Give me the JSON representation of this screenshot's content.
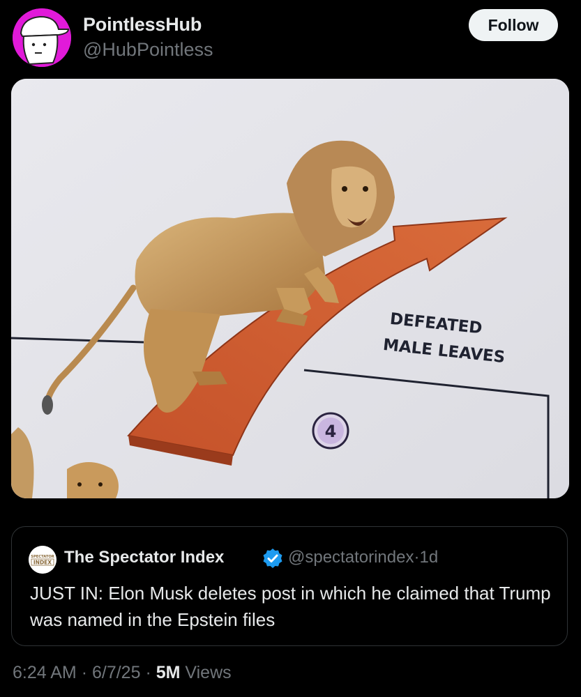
{
  "post": {
    "display_name": "PointlessHub",
    "handle": "@HubPointless",
    "follow_label": "Follow",
    "avatar_color": "#e11ad9"
  },
  "media": {
    "sign_line1": "DEFEATED",
    "sign_line2": "MALE LEAVES",
    "step_number": "4",
    "arrow_color": "#c8562a"
  },
  "quote": {
    "logo_line1": "SPECTATOR",
    "logo_line2": "INDEX",
    "name": "The Spectator Index",
    "verified_icon": "verified-badge-icon",
    "verified_color": "#1d9bf0",
    "handle": "@spectatorindex",
    "separator": "·",
    "age": "1d",
    "text": "JUST IN: Elon Musk deletes post in which he claimed that Trump was named in the Epstein files"
  },
  "footer": {
    "time": "6:24 AM",
    "date": "6/7/25",
    "views_count": "5M",
    "views_label": "Views",
    "separator": "·"
  }
}
